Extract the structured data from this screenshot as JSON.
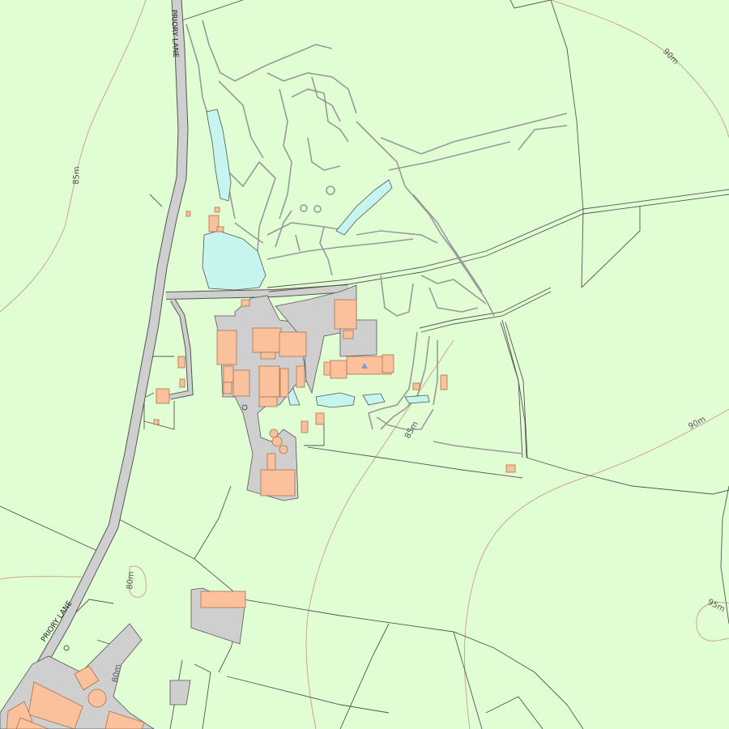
{
  "map": {
    "road_labels": [
      "PRIORY LANE",
      "PRIORY LANE"
    ],
    "contour_labels": [
      "85m",
      "90m",
      "85m",
      "90m",
      "80m",
      "95m",
      "80m"
    ],
    "colors": {
      "background": "#e0fdd3",
      "building": "#fbc19d",
      "building_outline": "#b07a5a",
      "paved": "#cfcfcf",
      "water": "#c6f4ef",
      "contour": "#c8a98a",
      "boundary": "#555555"
    }
  }
}
